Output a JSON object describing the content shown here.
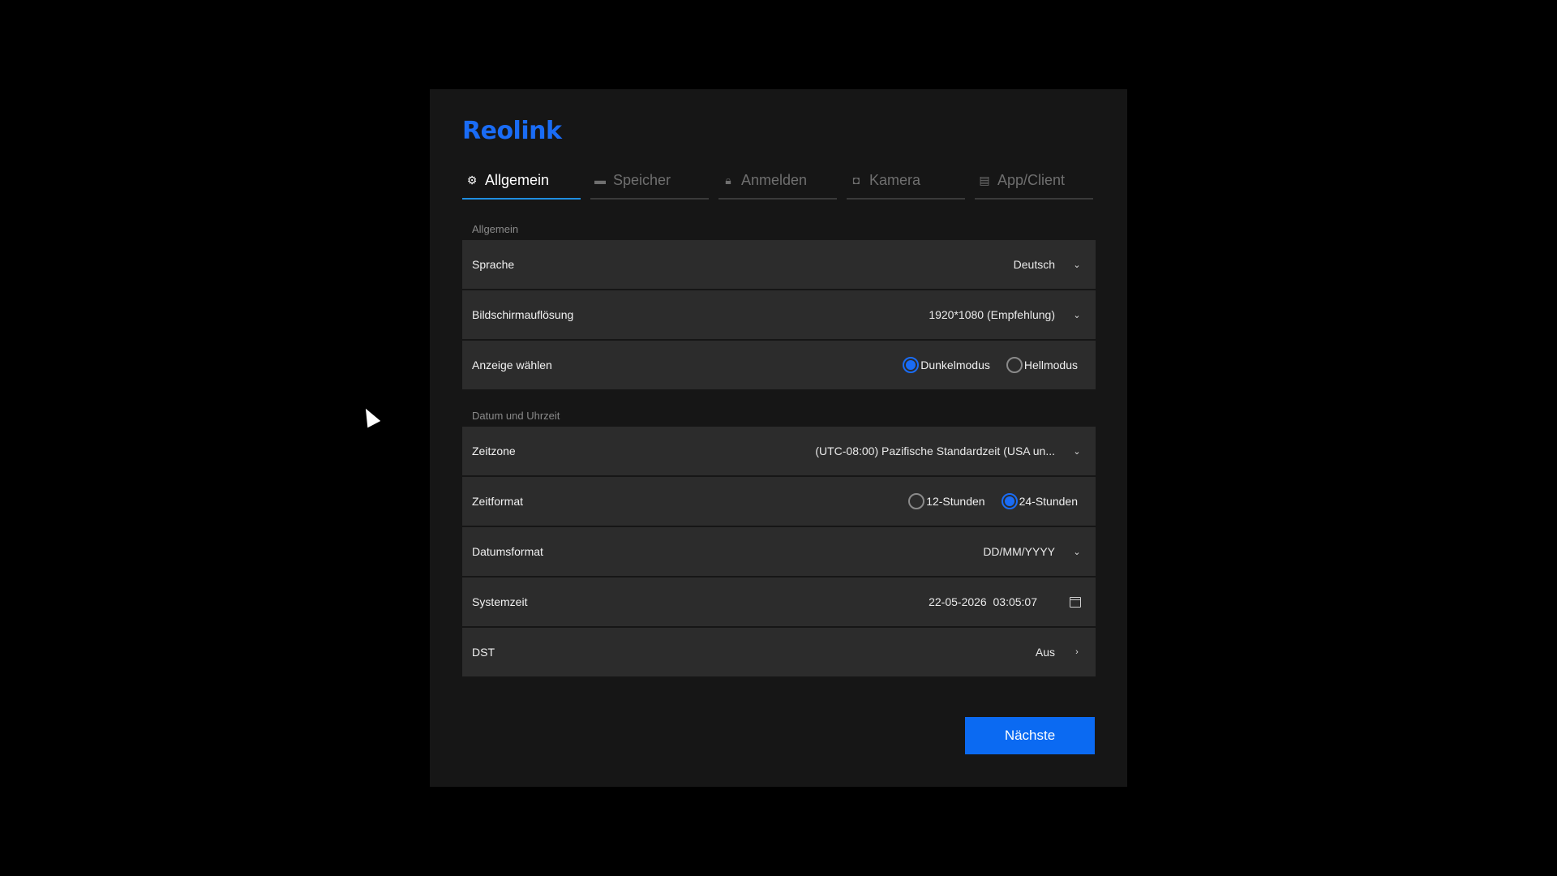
{
  "app": {
    "logo_text": "Reolink",
    "brand_color": "#1a6cf5"
  },
  "tabs": [
    {
      "label": "Allgemein",
      "icon": "gear-icon",
      "active": true
    },
    {
      "label": "Speicher",
      "icon": "folder-icon",
      "active": false
    },
    {
      "label": "Anmelden",
      "icon": "lock-icon",
      "active": false
    },
    {
      "label": "Kamera",
      "icon": "camera-icon",
      "active": false
    },
    {
      "label": "App/Client",
      "icon": "devices-icon",
      "active": false
    }
  ],
  "general": {
    "section_label": "Allgemein",
    "language": {
      "label": "Sprache",
      "value": "Deutsch"
    },
    "resolution": {
      "label": "Bildschirmauflösung",
      "value": "1920*1080 (Empfehlung)"
    },
    "display": {
      "label": "Anzeige wählen",
      "options": [
        {
          "label": "Dunkelmodus",
          "checked": true
        },
        {
          "label": "Hellmodus",
          "checked": false
        }
      ]
    }
  },
  "datetime": {
    "section_label": "Datum und Uhrzeit",
    "timezone": {
      "label": "Zeitzone",
      "value": "(UTC-08:00) Pazifische Standardzeit (USA un..."
    },
    "time_format": {
      "label": "Zeitformat",
      "options": [
        {
          "label": "12-Stunden",
          "checked": false
        },
        {
          "label": "24-Stunden",
          "checked": true
        }
      ]
    },
    "date_format": {
      "label": "Datumsformat",
      "value": "DD/MM/YYYY"
    },
    "system_time": {
      "label": "Systemzeit",
      "value": "22-05-2026  03:05:07"
    },
    "dst": {
      "label": "DST",
      "value": "Aus"
    }
  },
  "footer": {
    "next_label": "Nächste",
    "accent_color": "#0b6af2"
  }
}
